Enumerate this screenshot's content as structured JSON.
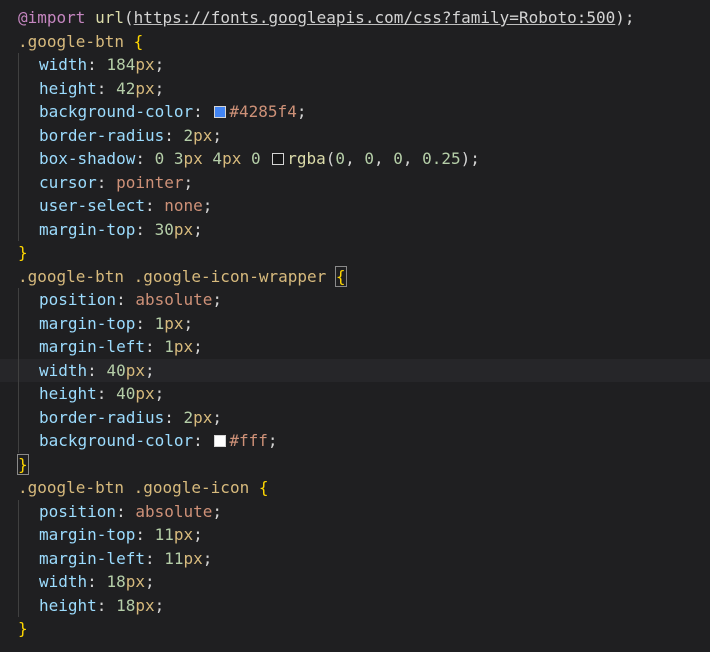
{
  "editor": {
    "partial_top_line": "  ⠀⠀<p> <a>⠀⠀g  g  ⠀⠀⠀ <g><g> g⠀g  ⠀⠀⠀ ⠀",
    "lines": [
      {
        "indent": false,
        "current": false,
        "tokens": [
          {
            "cls": "kw",
            "text": "@import"
          },
          {
            "cls": "punc",
            "text": " "
          },
          {
            "cls": "fn",
            "text": "url"
          },
          {
            "cls": "punc",
            "text": "("
          },
          {
            "cls": "url",
            "text": "https://fonts.googleapis.com/css?family=Roboto:500"
          },
          {
            "cls": "punc",
            "text": ");"
          }
        ]
      },
      {
        "indent": false,
        "current": false,
        "tokens": [
          {
            "cls": "sel",
            "text": ".google-btn"
          },
          {
            "cls": "punc",
            "text": " "
          },
          {
            "cls": "brace",
            "text": "{"
          }
        ]
      },
      {
        "indent": true,
        "current": false,
        "tokens": [
          {
            "cls": "prop",
            "text": "width"
          },
          {
            "cls": "punc",
            "text": ": "
          },
          {
            "cls": "num",
            "text": "184"
          },
          {
            "cls": "unit",
            "text": "px"
          },
          {
            "cls": "punc",
            "text": ";"
          }
        ]
      },
      {
        "indent": true,
        "current": false,
        "tokens": [
          {
            "cls": "prop",
            "text": "height"
          },
          {
            "cls": "punc",
            "text": ": "
          },
          {
            "cls": "num",
            "text": "42"
          },
          {
            "cls": "unit",
            "text": "px"
          },
          {
            "cls": "punc",
            "text": ";"
          }
        ]
      },
      {
        "indent": true,
        "current": false,
        "tokens": [
          {
            "cls": "prop",
            "text": "background-color"
          },
          {
            "cls": "punc",
            "text": ": "
          },
          {
            "cls": "swatch",
            "color": "#4285f4",
            "name": "color-swatch-blue"
          },
          {
            "cls": "hex",
            "text": "#4285f4"
          },
          {
            "cls": "punc",
            "text": ";"
          }
        ]
      },
      {
        "indent": true,
        "current": false,
        "tokens": [
          {
            "cls": "prop",
            "text": "border-radius"
          },
          {
            "cls": "punc",
            "text": ": "
          },
          {
            "cls": "num",
            "text": "2"
          },
          {
            "cls": "unit",
            "text": "px"
          },
          {
            "cls": "punc",
            "text": ";"
          }
        ]
      },
      {
        "indent": true,
        "current": false,
        "tokens": [
          {
            "cls": "prop",
            "text": "box-shadow"
          },
          {
            "cls": "punc",
            "text": ": "
          },
          {
            "cls": "num",
            "text": "0"
          },
          {
            "cls": "punc",
            "text": " "
          },
          {
            "cls": "num",
            "text": "3"
          },
          {
            "cls": "unit",
            "text": "px"
          },
          {
            "cls": "punc",
            "text": " "
          },
          {
            "cls": "num",
            "text": "4"
          },
          {
            "cls": "unit",
            "text": "px"
          },
          {
            "cls": "punc",
            "text": " "
          },
          {
            "cls": "num",
            "text": "0"
          },
          {
            "cls": "punc",
            "text": " "
          },
          {
            "cls": "swatch",
            "color": "rgba(0,0,0,0.25)",
            "name": "color-swatch-shadow"
          },
          {
            "cls": "fn",
            "text": "rgba"
          },
          {
            "cls": "punc",
            "text": "("
          },
          {
            "cls": "num",
            "text": "0"
          },
          {
            "cls": "punc",
            "text": ", "
          },
          {
            "cls": "num",
            "text": "0"
          },
          {
            "cls": "punc",
            "text": ", "
          },
          {
            "cls": "num",
            "text": "0"
          },
          {
            "cls": "punc",
            "text": ", "
          },
          {
            "cls": "num",
            "text": "0.25"
          },
          {
            "cls": "punc",
            "text": ");"
          }
        ]
      },
      {
        "indent": true,
        "current": false,
        "tokens": [
          {
            "cls": "prop",
            "text": "cursor"
          },
          {
            "cls": "punc",
            "text": ": "
          },
          {
            "cls": "ident",
            "text": "pointer"
          },
          {
            "cls": "punc",
            "text": ";"
          }
        ]
      },
      {
        "indent": true,
        "current": false,
        "tokens": [
          {
            "cls": "prop",
            "text": "user-select"
          },
          {
            "cls": "punc",
            "text": ": "
          },
          {
            "cls": "ident",
            "text": "none"
          },
          {
            "cls": "punc",
            "text": ";"
          }
        ]
      },
      {
        "indent": true,
        "current": false,
        "tokens": [
          {
            "cls": "prop",
            "text": "margin-top"
          },
          {
            "cls": "punc",
            "text": ": "
          },
          {
            "cls": "num",
            "text": "30"
          },
          {
            "cls": "unit",
            "text": "px"
          },
          {
            "cls": "punc",
            "text": ";"
          }
        ]
      },
      {
        "indent": false,
        "current": false,
        "tokens": [
          {
            "cls": "brace",
            "text": "}"
          }
        ]
      },
      {
        "indent": false,
        "current": false,
        "tokens": [
          {
            "cls": "sel",
            "text": ".google-btn"
          },
          {
            "cls": "punc",
            "text": " "
          },
          {
            "cls": "sel",
            "text": ".google-icon-wrapper"
          },
          {
            "cls": "punc",
            "text": " "
          },
          {
            "cls": "brace brace-box",
            "text": "{"
          }
        ]
      },
      {
        "indent": true,
        "current": false,
        "tokens": [
          {
            "cls": "prop",
            "text": "position"
          },
          {
            "cls": "punc",
            "text": ": "
          },
          {
            "cls": "ident",
            "text": "absolute"
          },
          {
            "cls": "punc",
            "text": ";"
          }
        ]
      },
      {
        "indent": true,
        "current": false,
        "tokens": [
          {
            "cls": "prop",
            "text": "margin-top"
          },
          {
            "cls": "punc",
            "text": ": "
          },
          {
            "cls": "num",
            "text": "1"
          },
          {
            "cls": "unit",
            "text": "px"
          },
          {
            "cls": "punc",
            "text": ";"
          }
        ]
      },
      {
        "indent": true,
        "current": false,
        "tokens": [
          {
            "cls": "prop",
            "text": "margin-left"
          },
          {
            "cls": "punc",
            "text": ": "
          },
          {
            "cls": "num",
            "text": "1"
          },
          {
            "cls": "unit",
            "text": "px"
          },
          {
            "cls": "punc",
            "text": ";"
          }
        ]
      },
      {
        "indent": true,
        "current": true,
        "tokens": [
          {
            "cls": "prop",
            "text": "width"
          },
          {
            "cls": "punc",
            "text": ": "
          },
          {
            "cls": "num",
            "text": "40"
          },
          {
            "cls": "unit",
            "text": "px"
          },
          {
            "cls": "punc",
            "text": ";"
          }
        ]
      },
      {
        "indent": true,
        "current": false,
        "tokens": [
          {
            "cls": "prop",
            "text": "height"
          },
          {
            "cls": "punc",
            "text": ": "
          },
          {
            "cls": "num",
            "text": "40"
          },
          {
            "cls": "unit",
            "text": "px"
          },
          {
            "cls": "punc",
            "text": ";"
          }
        ]
      },
      {
        "indent": true,
        "current": false,
        "tokens": [
          {
            "cls": "prop",
            "text": "border-radius"
          },
          {
            "cls": "punc",
            "text": ": "
          },
          {
            "cls": "num",
            "text": "2"
          },
          {
            "cls": "unit",
            "text": "px"
          },
          {
            "cls": "punc",
            "text": ";"
          }
        ]
      },
      {
        "indent": true,
        "current": false,
        "tokens": [
          {
            "cls": "prop",
            "text": "background-color"
          },
          {
            "cls": "punc",
            "text": ": "
          },
          {
            "cls": "swatch",
            "color": "#ffffff",
            "name": "color-swatch-white"
          },
          {
            "cls": "hex",
            "text": "#fff"
          },
          {
            "cls": "punc",
            "text": ";"
          }
        ]
      },
      {
        "indent": false,
        "current": false,
        "tokens": [
          {
            "cls": "brace brace-box",
            "text": "}"
          }
        ]
      },
      {
        "indent": false,
        "current": false,
        "tokens": [
          {
            "cls": "sel",
            "text": ".google-btn"
          },
          {
            "cls": "punc",
            "text": " "
          },
          {
            "cls": "sel",
            "text": ".google-icon"
          },
          {
            "cls": "punc",
            "text": " "
          },
          {
            "cls": "brace",
            "text": "{"
          }
        ]
      },
      {
        "indent": true,
        "current": false,
        "tokens": [
          {
            "cls": "prop",
            "text": "position"
          },
          {
            "cls": "punc",
            "text": ": "
          },
          {
            "cls": "ident",
            "text": "absolute"
          },
          {
            "cls": "punc",
            "text": ";"
          }
        ]
      },
      {
        "indent": true,
        "current": false,
        "tokens": [
          {
            "cls": "prop",
            "text": "margin-top"
          },
          {
            "cls": "punc",
            "text": ": "
          },
          {
            "cls": "num",
            "text": "11"
          },
          {
            "cls": "unit",
            "text": "px"
          },
          {
            "cls": "punc",
            "text": ";"
          }
        ]
      },
      {
        "indent": true,
        "current": false,
        "tokens": [
          {
            "cls": "prop",
            "text": "margin-left"
          },
          {
            "cls": "punc",
            "text": ": "
          },
          {
            "cls": "num",
            "text": "11"
          },
          {
            "cls": "unit",
            "text": "px"
          },
          {
            "cls": "punc",
            "text": ";"
          }
        ]
      },
      {
        "indent": true,
        "current": false,
        "tokens": [
          {
            "cls": "prop",
            "text": "width"
          },
          {
            "cls": "punc",
            "text": ": "
          },
          {
            "cls": "num",
            "text": "18"
          },
          {
            "cls": "unit",
            "text": "px"
          },
          {
            "cls": "punc",
            "text": ";"
          }
        ]
      },
      {
        "indent": true,
        "current": false,
        "tokens": [
          {
            "cls": "prop",
            "text": "height"
          },
          {
            "cls": "punc",
            "text": ": "
          },
          {
            "cls": "num",
            "text": "18"
          },
          {
            "cls": "unit",
            "text": "px"
          },
          {
            "cls": "punc",
            "text": ";"
          }
        ]
      },
      {
        "indent": false,
        "current": false,
        "tokens": [
          {
            "cls": "brace",
            "text": "}"
          }
        ]
      }
    ]
  }
}
